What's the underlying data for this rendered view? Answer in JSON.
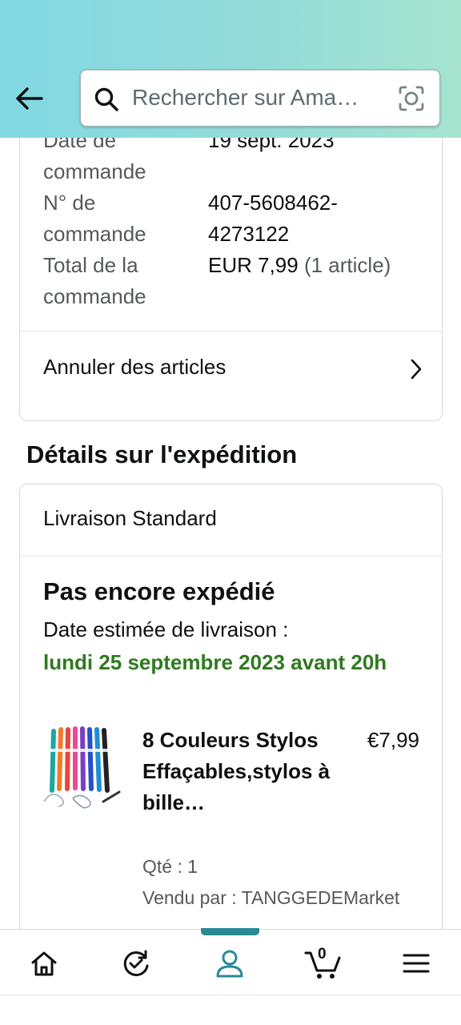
{
  "header": {
    "search_placeholder": "Rechercher sur Ama…",
    "icons": {
      "back": "arrow-left-icon",
      "search": "search-icon",
      "lens": "camera-lens-icon"
    }
  },
  "order_summary": {
    "rows": [
      {
        "label": "Date de commande",
        "value": "19 sept. 2023",
        "extra": ""
      },
      {
        "label": "N° de commande",
        "value": "407-5608462-4273122",
        "extra": ""
      },
      {
        "label": "Total de la commande",
        "value": "EUR 7,99",
        "extra": "(1 article)"
      }
    ],
    "cancel_label": "Annuler des articles"
  },
  "shipment": {
    "section_title": "Détails sur l'expédition",
    "method": "Livraison Standard",
    "status": "Pas encore expédié",
    "estimate_label": "Date estimée de livraison :",
    "estimate_date": "lundi 25 septembre 2023 avant 20h",
    "status_color": "#2f7a1f",
    "product": {
      "title": "8 Couleurs Stylos Effaçables,stylos à bille…",
      "price": "€7,99",
      "qty": "Qté : 1",
      "seller": "Vendu par : TANGGEDEMarket"
    }
  },
  "bottom_nav": {
    "active_color": "#2a8997",
    "cart_count": "0",
    "items": [
      "home-icon",
      "refresh-check-icon",
      "account-icon",
      "cart-icon",
      "menu-icon"
    ]
  }
}
